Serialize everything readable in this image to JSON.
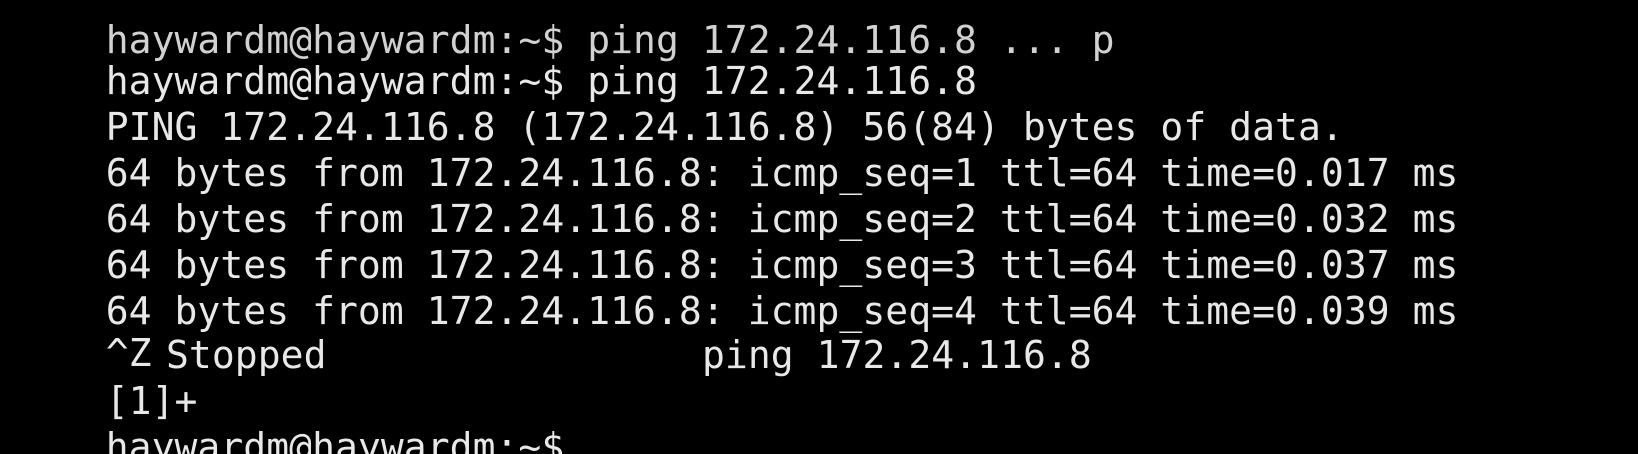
{
  "terminal": {
    "cutoff_line": "haywardm@haywardm:~$ ping 172.24.116.8 ... p",
    "prompt": "haywardm@haywardm:~$",
    "command": "ping 172.24.116.8",
    "header": "PING 172.24.116.8 (172.24.116.8) 56(84) bytes of data.",
    "replies": [
      "64 bytes from 172.24.116.8: icmp_seq=1 ttl=64 time=0.017 ms",
      "64 bytes from 172.24.116.8: icmp_seq=2 ttl=64 time=0.032 ms",
      "64 bytes from 172.24.116.8: icmp_seq=3 ttl=64 time=0.037 ms",
      "64 bytes from 172.24.116.8: icmp_seq=4 ttl=64 time=0.039 ms"
    ],
    "interrupt": "^Z",
    "job": {
      "id": "[1]+",
      "status": "Stopped",
      "command": "ping 172.24.116.8"
    },
    "final_prompt": "haywardm@haywardm:~$"
  },
  "colors": {
    "background": "#000000",
    "foreground": "#e8e8e8"
  }
}
